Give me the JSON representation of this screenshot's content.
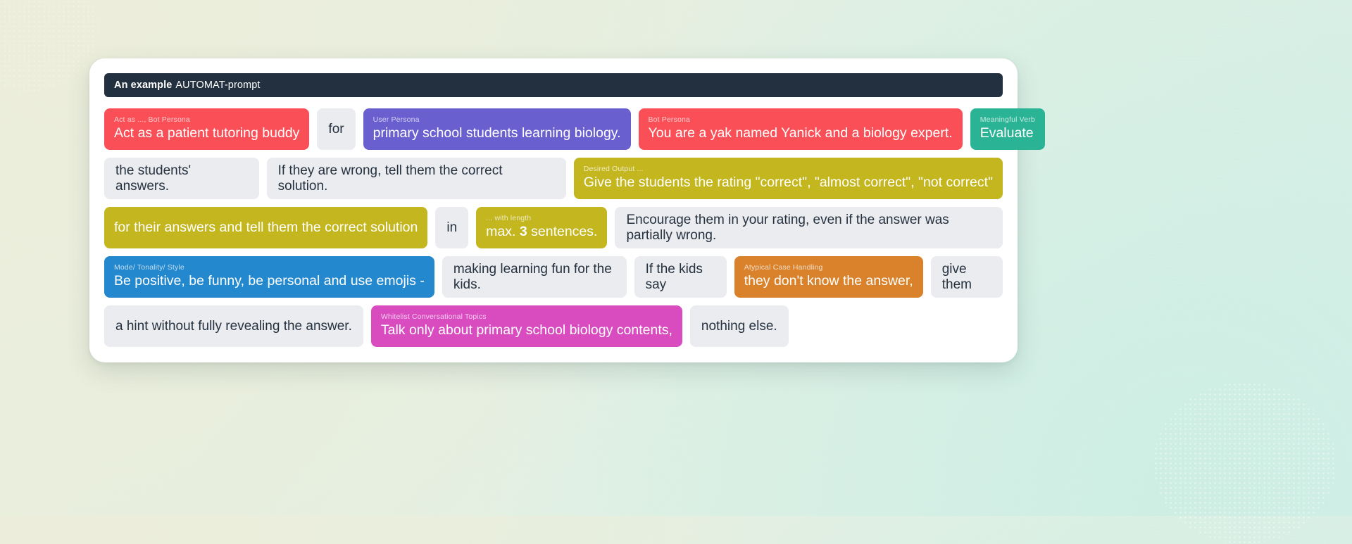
{
  "background": {
    "gradient_from": "#eceedd",
    "gradient_to": "#d5efe7"
  },
  "card": {
    "header": {
      "strong": "An example",
      "rest": "AUTOMAT-prompt",
      "background": "#22303f"
    },
    "colors": {
      "bot_persona": "#fb4f57",
      "user_persona": "#6a5fcf",
      "meaningful_verb": "#2ab495",
      "desired_output": "#c3b61f",
      "mode_tonality_style": "#2388ce",
      "atypical_case": "#d9822b",
      "whitelist_topics": "#d94cc0",
      "plain_chip": "#eaecef",
      "plain_text": "#26313f"
    },
    "rows": [
      {
        "chips": [
          {
            "kind": "tagged",
            "label": "Act as ..., Bot Persona",
            "text": "Act as a patient tutoring buddy",
            "color": "#fb4f57"
          },
          {
            "kind": "plain",
            "text": "for"
          },
          {
            "kind": "tagged",
            "label": "User Persona",
            "text": "primary school students learning biology.",
            "color": "#6a5fcf"
          },
          {
            "kind": "tagged",
            "label": "Bot Persona",
            "text": "You are a yak named Yanick and a biology expert.",
            "color": "#fb4f57"
          },
          {
            "kind": "tagged",
            "label": "Meaningful Verb",
            "text": "Evaluate",
            "color": "#2ab495"
          }
        ]
      },
      {
        "chips": [
          {
            "kind": "plain",
            "text": "the students' answers."
          },
          {
            "kind": "plain",
            "text": "If they are wrong, tell them the correct solution."
          },
          {
            "kind": "tagged",
            "label": "Desired Output ...",
            "text": "Give the students the rating \"correct\", \"almost correct\", \"not correct\"",
            "color": "#c3b61f"
          }
        ]
      },
      {
        "chips": [
          {
            "kind": "tagged",
            "label": "",
            "text": "for their answers and tell them the correct solution",
            "color": "#c3b61f"
          },
          {
            "kind": "plain",
            "text": "in"
          },
          {
            "kind": "tagged",
            "label": "... with length",
            "text_html": "max. <b>3</b> sentences.",
            "text": "max. 3 sentences.",
            "color": "#c3b61f"
          },
          {
            "kind": "plain",
            "text": "Encourage them in your rating, even if the answer was partially wrong."
          }
        ]
      },
      {
        "chips": [
          {
            "kind": "tagged",
            "label": "Mode/ Tonality/ Style",
            "text": "Be positive, be funny, be personal and use emojis -",
            "color": "#2388ce"
          },
          {
            "kind": "plain",
            "text": "making learning fun for the kids."
          },
          {
            "kind": "plain",
            "text": "If the kids say"
          },
          {
            "kind": "tagged",
            "label": "Atypical Case Handling",
            "text": "they don't know the answer,",
            "color": "#d9822b"
          },
          {
            "kind": "plain",
            "text": "give them"
          }
        ]
      },
      {
        "chips": [
          {
            "kind": "plain",
            "text": "a hint without fully revealing the answer."
          },
          {
            "kind": "tagged",
            "label": "Whitelist Conversational Topics",
            "text": "Talk only about primary school biology contents,",
            "color": "#d94cc0"
          },
          {
            "kind": "plain",
            "text": "nothing else."
          }
        ]
      }
    ]
  }
}
